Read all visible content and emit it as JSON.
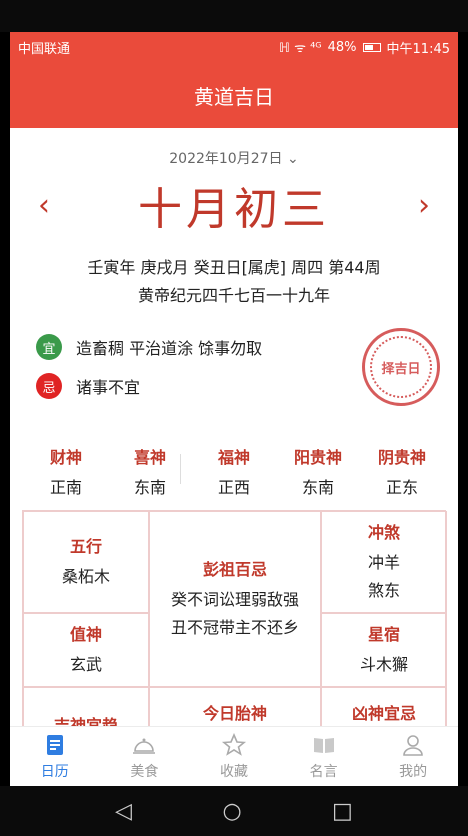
{
  "status_bar": {
    "carrier": "中国联通",
    "indicators": "ℍ ᯤ ⁴ᴳ",
    "battery": "48%",
    "time": "中午11:45"
  },
  "app_title": "黄道吉日",
  "date_selector": "2022年10月27日",
  "lunar": {
    "prev_arrow": "‹",
    "date": "十月初三",
    "next_arrow": "›"
  },
  "ganzhi_line": "壬寅年 庚戌月 癸丑日[属虎] 周四 第44周",
  "era_line": "黄帝纪元四千七百一十九年",
  "yi": {
    "badge": "宜",
    "text": "造畜稠 平治道涂 馀事勿取"
  },
  "ji": {
    "badge": "忌",
    "text": "诸事不宜"
  },
  "stamp_text": "择吉日",
  "gods": [
    {
      "title": "财神",
      "value": "正南"
    },
    {
      "title": "喜神",
      "value": "东南"
    },
    {
      "title": "福神",
      "value": "正西"
    },
    {
      "title": "阳贵神",
      "value": "东南"
    },
    {
      "title": "阴贵神",
      "value": "正东"
    }
  ],
  "grid": {
    "wuxing": {
      "title": "五行",
      "value": "桑柘木"
    },
    "pengzu": {
      "title": "彭祖百忌",
      "line1": "癸不词讼理弱敌强",
      "line2": "丑不冠带主不还乡"
    },
    "chongsha": {
      "title": "冲煞",
      "line1": "冲羊",
      "line2": "煞东"
    },
    "zhishen": {
      "title": "值神",
      "value": "玄武"
    },
    "xingxiu": {
      "title": "星宿",
      "value": "斗木獬"
    },
    "jishen": {
      "title": "吉神宜趋"
    },
    "taishen": {
      "title": "今日胎神"
    },
    "xiongshen": {
      "title": "凶神宜忌"
    }
  },
  "tabs": [
    {
      "label": "日历",
      "icon": "calendar-icon",
      "active": true
    },
    {
      "label": "美食",
      "icon": "cloche-icon"
    },
    {
      "label": "收藏",
      "icon": "star-icon"
    },
    {
      "label": "名言",
      "icon": "book-icon"
    },
    {
      "label": "我的",
      "icon": "person-icon"
    }
  ],
  "colors": {
    "primary": "#ea4b3b",
    "accent_text": "#c0392b",
    "tab_active": "#2f7de1",
    "yi_green": "#3a9a4a",
    "ji_red": "#e02424"
  }
}
